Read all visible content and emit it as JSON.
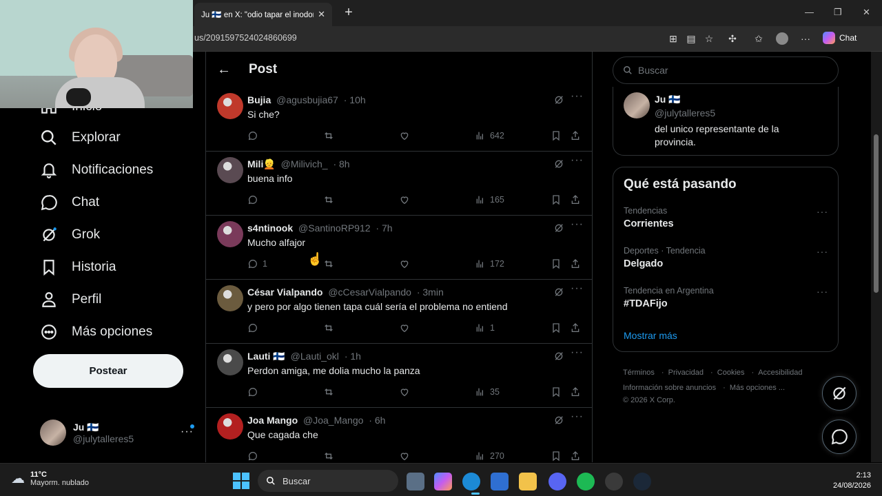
{
  "browser": {
    "tab_title": "Ju 🇫🇮 en X: \"odio tapar el inodoro s",
    "url": "us/2091597524024860699",
    "chat_label": "Chat"
  },
  "nav": {
    "items": [
      {
        "label": "Inicio",
        "icon": "home-icon"
      },
      {
        "label": "Explorar",
        "icon": "search-icon"
      },
      {
        "label": "Notificaciones",
        "icon": "bell-icon"
      },
      {
        "label": "Chat",
        "icon": "chat-icon"
      },
      {
        "label": "Grok",
        "icon": "grok-icon"
      },
      {
        "label": "Historia",
        "icon": "bookmark-icon"
      },
      {
        "label": "Perfil",
        "icon": "person-icon"
      },
      {
        "label": "Más opciones",
        "icon": "more-circle-icon"
      }
    ],
    "post_button": "Postear",
    "account": {
      "name": "Ju 🇫🇮",
      "handle": "@julytalleres5"
    }
  },
  "header": {
    "title": "Post"
  },
  "replies": [
    {
      "name": "Bujia",
      "handle": "@agusbujia67",
      "time": "· 10h",
      "text": "Si che?",
      "replies": "",
      "views": "642",
      "avatar_color": "#c0392b"
    },
    {
      "name": "Mili👱",
      "handle": "@Milivich_",
      "time": "· 8h",
      "text": "buena info",
      "replies": "",
      "views": "165",
      "avatar_color": "#5a4a52"
    },
    {
      "name": "s4ntinook",
      "handle": "@SantinoRP912",
      "time": "· 7h",
      "text": "Mucho alfajor",
      "replies": "1",
      "views": "172",
      "avatar_color": "#7a3a5a"
    },
    {
      "name": "César Vialpando",
      "handle": "@cCesarVialpando",
      "time": "· 3min",
      "text": "y pero por algo tienen tapa cuál sería el problema no entiend",
      "replies": "",
      "views": "1",
      "avatar_color": "#6b5b3e"
    },
    {
      "name": "Lauti 🇫🇮",
      "handle": "@Lauti_okl",
      "time": "· 1h",
      "text": "Perdon amiga, me dolia mucho la panza",
      "replies": "",
      "views": "35",
      "avatar_color": "#4a4a4a"
    },
    {
      "name": "Joa Mango",
      "handle": "@Joa_Mango",
      "time": "· 6h",
      "text": "Que cagada che",
      "replies": "",
      "views": "270",
      "avatar_color": "#b32020"
    }
  ],
  "right": {
    "search_placeholder": "Buscar",
    "quoted": {
      "name": "Ju 🇫🇮",
      "handle": "@julytalleres5",
      "text": "del unico representante de la provincia."
    },
    "trends_title": "Qué está pasando",
    "trends": [
      {
        "context": "Tendencias",
        "topic": "Corrientes"
      },
      {
        "context": "Deportes · Tendencia",
        "topic": "Delgado"
      },
      {
        "context": "Tendencia en Argentina",
        "topic": "#TDAFijo"
      }
    ],
    "show_more": "Mostrar más",
    "footer": [
      "Términos",
      "Privacidad",
      "Cookies",
      "Accesibilidad",
      "Información sobre anuncios",
      "Más opciones ...",
      "© 2026 X Corp."
    ]
  },
  "taskbar": {
    "temp": "11°C",
    "condition": "Mayorm. nublado",
    "search": "Buscar",
    "time": "2:13",
    "date": "24/08/2026"
  },
  "colors": {
    "accent": "#1d9bf0",
    "bg": "#000000",
    "border": "#2f3336",
    "muted": "#71767b"
  }
}
